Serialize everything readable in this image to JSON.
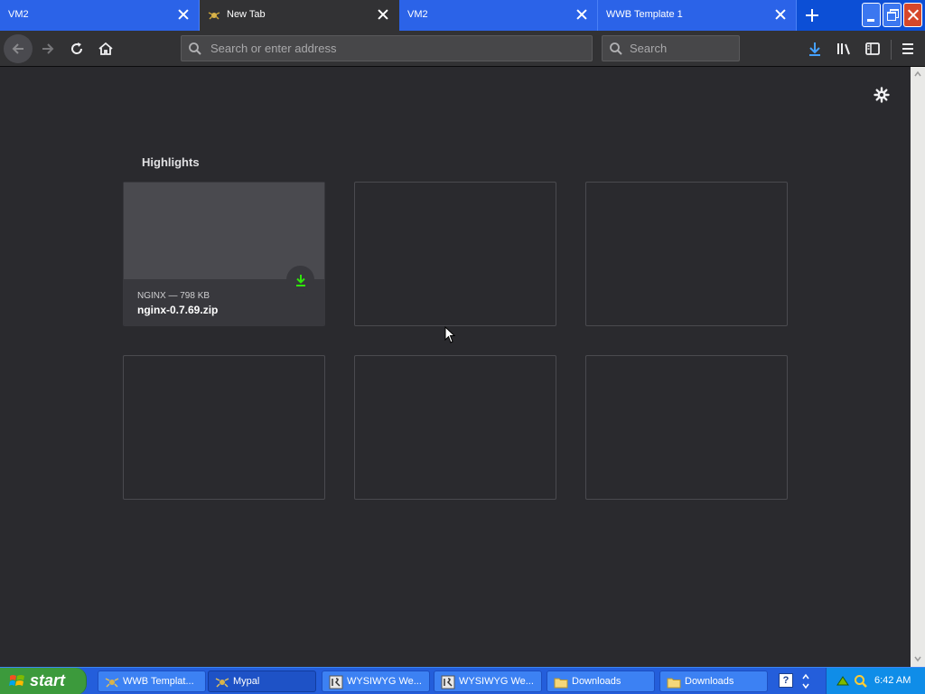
{
  "browser": {
    "tabs": [
      {
        "title": "VM2",
        "selected": false
      },
      {
        "title": "New Tab",
        "selected": true
      },
      {
        "title": "VM2",
        "selected": false
      },
      {
        "title": "WWB Template 1",
        "selected": false
      }
    ],
    "urlbar": {
      "placeholder": "Search or enter address",
      "value": ""
    },
    "searchbar": {
      "placeholder": "Search",
      "value": ""
    }
  },
  "newtab": {
    "section_title": "Highlights",
    "cards": [
      {
        "source": "NGINX — 798 KB",
        "title": "nginx-0.7.69.zip",
        "type": "download",
        "accent_color": "#30e60b"
      },
      {
        "source": "",
        "title": "",
        "type": "empty"
      },
      {
        "source": "",
        "title": "",
        "type": "empty"
      },
      {
        "source": "",
        "title": "",
        "type": "empty"
      },
      {
        "source": "",
        "title": "",
        "type": "empty"
      },
      {
        "source": "",
        "title": "",
        "type": "empty"
      }
    ]
  },
  "taskbar": {
    "start_label": "start",
    "tasks": [
      {
        "label": "WWB Templat...",
        "icon": "wwb-icon",
        "active": false
      },
      {
        "label": "Mypal",
        "icon": "mypal-icon",
        "active": true
      },
      {
        "label": "WYSIWYG We...",
        "icon": "wysiwyg-icon",
        "active": false
      },
      {
        "label": "WYSIWYG We...",
        "icon": "wysiwyg-icon",
        "active": false
      },
      {
        "label": "Downloads",
        "icon": "folder-icon",
        "active": false
      },
      {
        "label": "Downloads",
        "icon": "folder-icon",
        "active": false
      }
    ],
    "help_icon_glyph": "?",
    "clock": "6:42 AM"
  },
  "colors": {
    "download_accent": "#30e60b",
    "background": "#2a2a2e"
  }
}
